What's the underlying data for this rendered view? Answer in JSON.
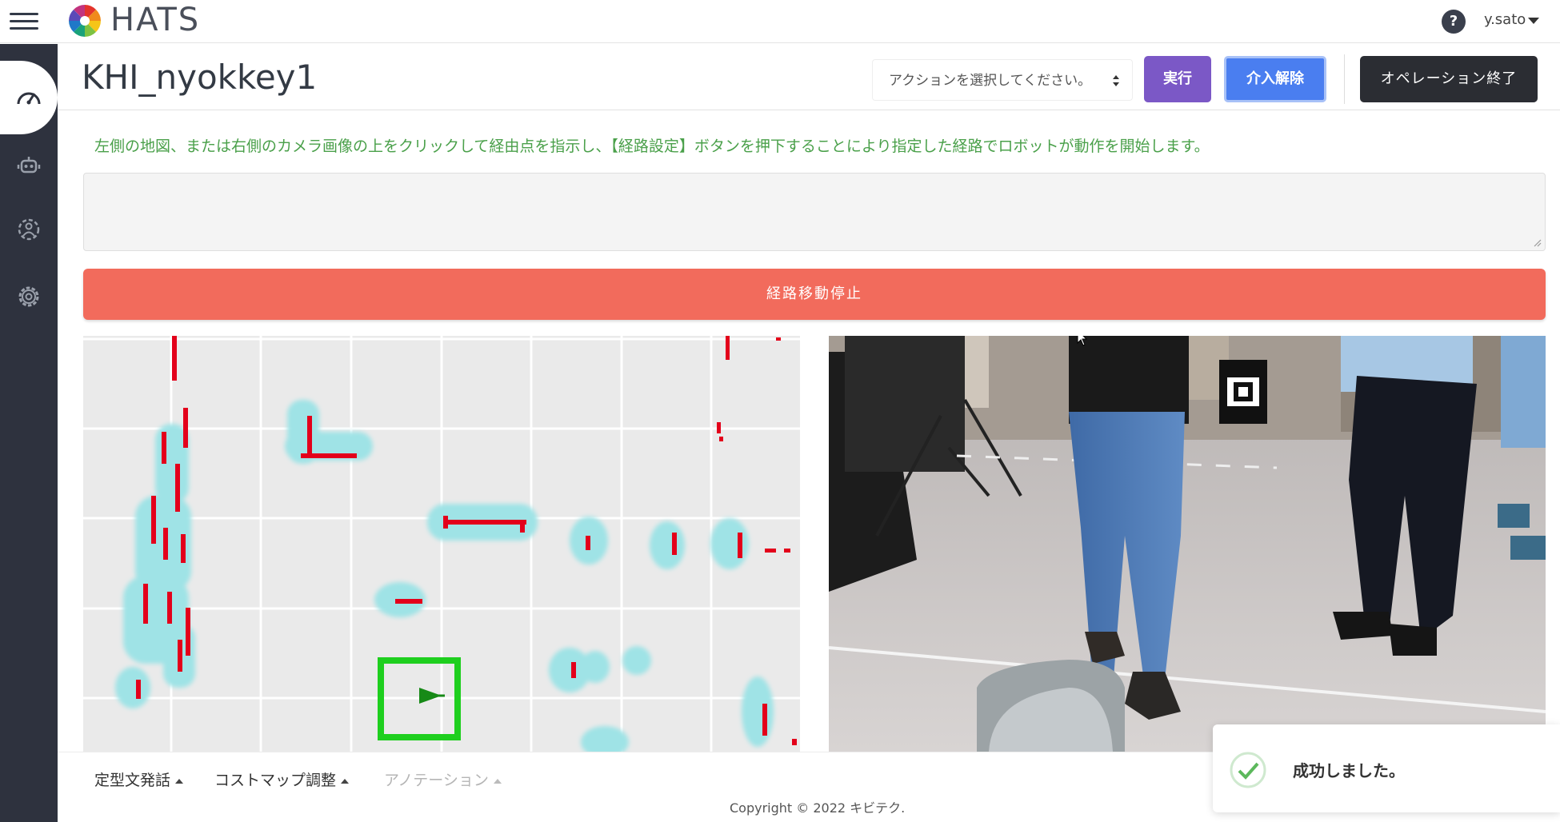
{
  "header": {
    "brand": "HATS",
    "user": "y.sato",
    "help_symbol": "?"
  },
  "sidebar": {
    "items": [
      {
        "icon": "speedometer-icon",
        "active": true
      },
      {
        "icon": "robot-icon",
        "active": false
      },
      {
        "icon": "gear-person-icon",
        "active": false
      },
      {
        "icon": "settings-gear-icon",
        "active": false
      }
    ]
  },
  "page": {
    "title": "KHI_nyokkey1",
    "action_select_placeholder": "アクションを選択してください。",
    "exec_label": "実行",
    "release_label": "介入解除",
    "end_label": "オペレーション終了",
    "instruction": "左側の地図、または右側のカメラ画像の上をクリックして経由点を指示し、【経路設定】ボタンを押下することにより指定した経路でロボットが動作を開始します。",
    "stop_label": "経路移動停止"
  },
  "footer": {
    "links": [
      "定型文発話",
      "コストマップ調整",
      "アノテーション"
    ],
    "copyright": "Copyright © 2022 キビテク."
  },
  "toast": {
    "message": "成功しました。"
  },
  "colors": {
    "sidebar": "#2e323e",
    "exec": "#7b58c6",
    "release": "#4a7ef0",
    "end": "#2b2d33",
    "stop": "#f26b5c",
    "instruction": "#4aa04a",
    "costmap_inflation": "#9fe3e6",
    "obstacle": "#e3001b",
    "robot": "#1ecf1e"
  }
}
